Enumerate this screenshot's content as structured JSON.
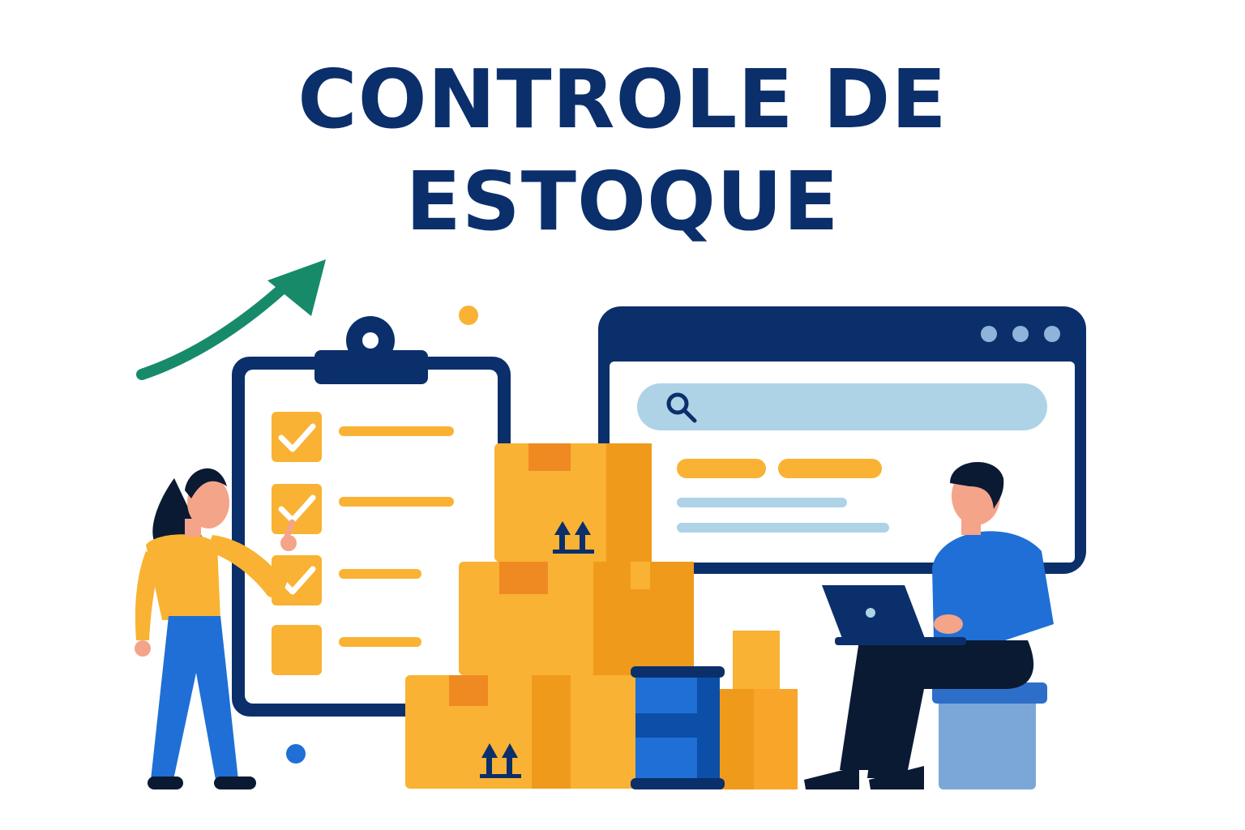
{
  "title": {
    "line1": "CONTROLE DE",
    "line2": "ESTOQUE"
  },
  "colors": {
    "navy": "#0b2f6b",
    "orange": "#f9b233",
    "orange_dark": "#f09a1c",
    "green": "#178a6a",
    "blue": "#1f6fd6",
    "light_blue": "#aed3e6"
  },
  "icons": {
    "search": "search-icon",
    "trend": "trend-up-arrow-icon",
    "checkbox": "checkbox-icon",
    "fragile": "this-side-up-icon"
  },
  "checklist": [
    {
      "checked": true
    },
    {
      "checked": true
    },
    {
      "checked": true
    },
    {
      "checked": false
    }
  ]
}
